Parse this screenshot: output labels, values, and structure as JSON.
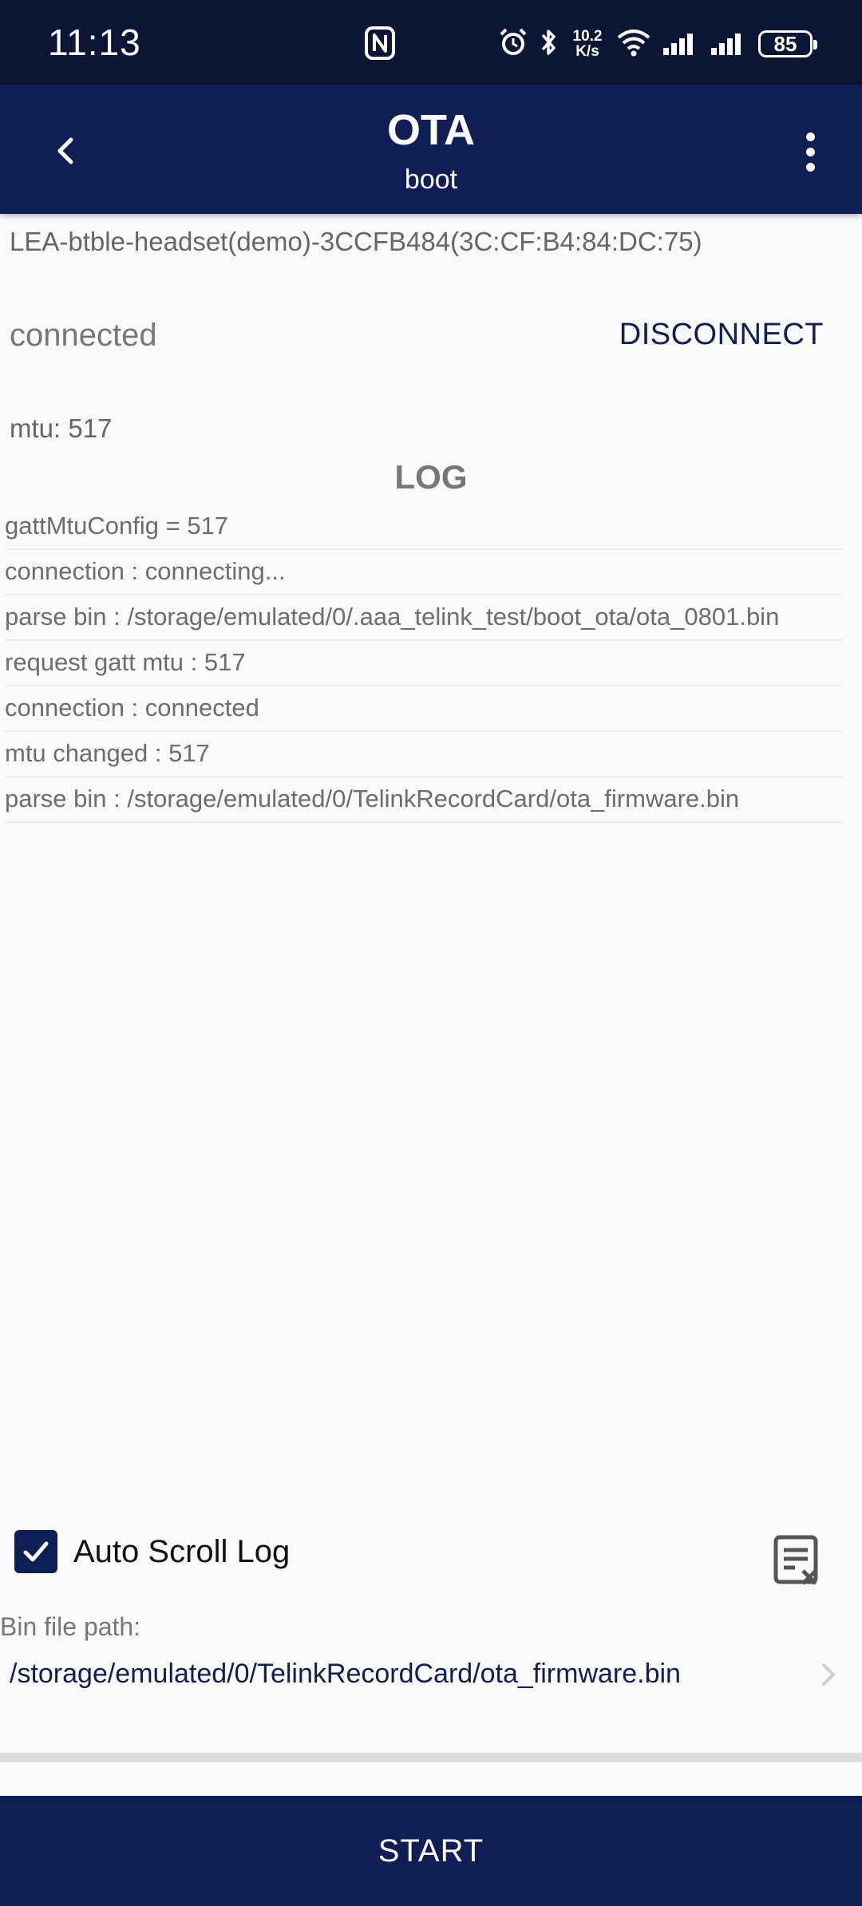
{
  "status_bar": {
    "time": "11:13",
    "net_speed_value": "10.2",
    "net_speed_unit": "K/s",
    "battery": "85"
  },
  "app_bar": {
    "title": "OTA",
    "subtitle": "boot"
  },
  "device": {
    "name": "LEA-btble-headset(demo)-3CCFB484(3C:CF:B4:84:DC:75)",
    "state": "connected",
    "disconnect_label": "DISCONNECT",
    "mtu": "mtu: 517"
  },
  "log": {
    "title": "LOG",
    "entries": [
      "gattMtuConfig = 517",
      "connection : connecting...",
      "parse bin : /storage/emulated/0/.aaa_telink_test/boot_ota/ota_0801.bin",
      "request gatt mtu : 517",
      "connection : connected",
      "mtu changed : 517",
      "parse bin : /storage/emulated/0/TelinkRecordCard/ota_firmware.bin"
    ]
  },
  "options": {
    "auto_scroll_label": "Auto Scroll Log",
    "auto_scroll_checked": true
  },
  "bin_file": {
    "label": "Bin file path:",
    "path": "/storage/emulated/0/TelinkRecordCard/ota_firmware.bin"
  },
  "actions": {
    "start_label": "START"
  },
  "colors": {
    "primary": "#0f1e55",
    "status_bar": "#0b1634",
    "background": "#fafafa"
  }
}
